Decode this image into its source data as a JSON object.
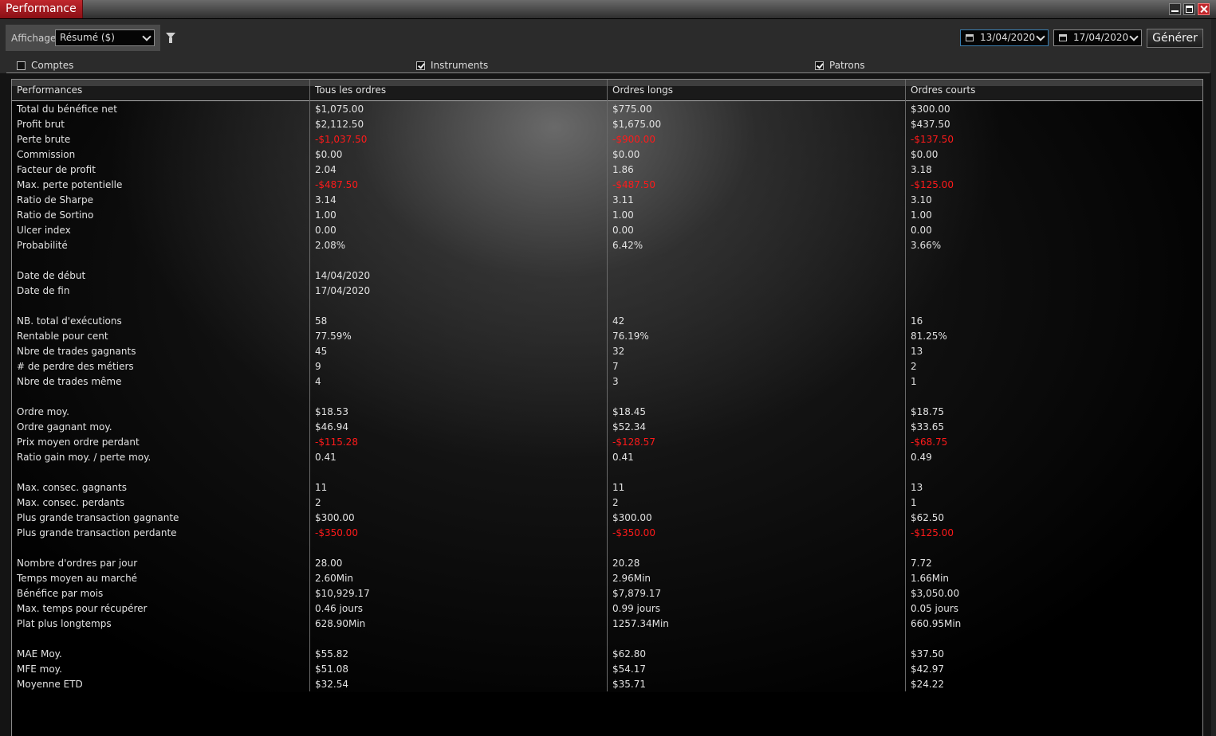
{
  "window": {
    "title": "Performance"
  },
  "toolbar": {
    "display_label": "Affichage",
    "display_value": "Résumé ($)",
    "date_from": "13/04/2020",
    "date_to": "17/04/2020",
    "generate_label": "Générer"
  },
  "checkboxes": [
    {
      "label": "Comptes",
      "checked": false
    },
    {
      "label": "Instruments",
      "checked": true
    },
    {
      "label": "Patrons",
      "checked": true
    }
  ],
  "grid": {
    "columns": [
      "Performances",
      "Tous les ordres",
      "Ordres longs",
      "Ordres courts"
    ],
    "rows": [
      {
        "label": "Total du bénéfice net",
        "values": [
          "$1,075.00",
          "$775.00",
          "$300.00"
        ]
      },
      {
        "label": "Profit brut",
        "values": [
          "$2,112.50",
          "$1,675.00",
          "$437.50"
        ]
      },
      {
        "label": "Perte brute",
        "values": [
          "-$1,037.50",
          "-$900.00",
          "-$137.50"
        ],
        "negative": [
          true,
          true,
          true
        ]
      },
      {
        "label": "Commission",
        "values": [
          "$0.00",
          "$0.00",
          "$0.00"
        ]
      },
      {
        "label": "Facteur de profit",
        "values": [
          "2.04",
          "1.86",
          "3.18"
        ]
      },
      {
        "label": "Max. perte potentielle",
        "values": [
          "-$487.50",
          "-$487.50",
          "-$125.00"
        ],
        "negative": [
          true,
          true,
          true
        ]
      },
      {
        "label": "Ratio de Sharpe",
        "values": [
          "3.14",
          "3.11",
          "3.10"
        ]
      },
      {
        "label": "Ratio de Sortino",
        "values": [
          "1.00",
          "1.00",
          "1.00"
        ]
      },
      {
        "label": "Ulcer index",
        "values": [
          "0.00",
          "0.00",
          "0.00"
        ]
      },
      {
        "label": "Probabilité",
        "values": [
          "2.08%",
          "6.42%",
          "3.66%"
        ]
      },
      {
        "label": "",
        "values": [
          "",
          "",
          ""
        ]
      },
      {
        "label": "Date de début",
        "values": [
          "14/04/2020",
          "",
          ""
        ]
      },
      {
        "label": "Date de fin",
        "values": [
          "17/04/2020",
          "",
          ""
        ]
      },
      {
        "label": "",
        "values": [
          "",
          "",
          ""
        ]
      },
      {
        "label": "NB. total d'exécutions",
        "values": [
          "58",
          "42",
          "16"
        ]
      },
      {
        "label": "Rentable pour cent",
        "values": [
          "77.59%",
          "76.19%",
          "81.25%"
        ]
      },
      {
        "label": "Nbre de trades gagnants",
        "values": [
          "45",
          "32",
          "13"
        ]
      },
      {
        "label": "# de perdre des métiers",
        "values": [
          "9",
          "7",
          "2"
        ]
      },
      {
        "label": "Nbre de trades même",
        "values": [
          "4",
          "3",
          "1"
        ]
      },
      {
        "label": "",
        "values": [
          "",
          "",
          ""
        ]
      },
      {
        "label": "Ordre moy.",
        "values": [
          "$18.53",
          "$18.45",
          "$18.75"
        ]
      },
      {
        "label": "Ordre gagnant moy.",
        "values": [
          "$46.94",
          "$52.34",
          "$33.65"
        ]
      },
      {
        "label": "Prix moyen ordre perdant",
        "values": [
          "-$115.28",
          "-$128.57",
          "-$68.75"
        ],
        "negative": [
          true,
          true,
          true
        ]
      },
      {
        "label": "Ratio gain moy. / perte moy.",
        "values": [
          "0.41",
          "0.41",
          "0.49"
        ]
      },
      {
        "label": "",
        "values": [
          "",
          "",
          ""
        ]
      },
      {
        "label": "Max. consec. gagnants",
        "values": [
          "11",
          "11",
          "13"
        ]
      },
      {
        "label": "Max. consec. perdants",
        "values": [
          "2",
          "2",
          "1"
        ]
      },
      {
        "label": "Plus grande transaction gagnante",
        "values": [
          "$300.00",
          "$300.00",
          "$62.50"
        ]
      },
      {
        "label": "Plus grande transaction perdante",
        "values": [
          "-$350.00",
          "-$350.00",
          "-$125.00"
        ],
        "negative": [
          true,
          true,
          true
        ]
      },
      {
        "label": "",
        "values": [
          "",
          "",
          ""
        ]
      },
      {
        "label": "Nombre d'ordres par jour",
        "values": [
          "28.00",
          "20.28",
          "7.72"
        ]
      },
      {
        "label": "Temps moyen au marché",
        "values": [
          "2.60Min",
          "2.96Min",
          "1.66Min"
        ]
      },
      {
        "label": "Bénéfice par mois",
        "values": [
          "$10,929.17",
          "$7,879.17",
          "$3,050.00"
        ]
      },
      {
        "label": "Max. temps pour récupérer",
        "values": [
          "0.46 jours",
          "0.99 jours",
          "0.05 jours"
        ]
      },
      {
        "label": "Plat plus longtemps",
        "values": [
          "628.90Min",
          "1257.34Min",
          "660.95Min"
        ]
      },
      {
        "label": "",
        "values": [
          "",
          "",
          ""
        ]
      },
      {
        "label": "MAE Moy.",
        "values": [
          "$55.82",
          "$62.80",
          "$37.50"
        ]
      },
      {
        "label": "MFE moy.",
        "values": [
          "$51.08",
          "$54.17",
          "$42.97"
        ]
      },
      {
        "label": "Moyenne ETD",
        "values": [
          "$32.54",
          "$35.71",
          "$24.22"
        ]
      }
    ]
  },
  "colors": {
    "negative": "#ff1a1a",
    "title_tab": "#c0272d"
  }
}
